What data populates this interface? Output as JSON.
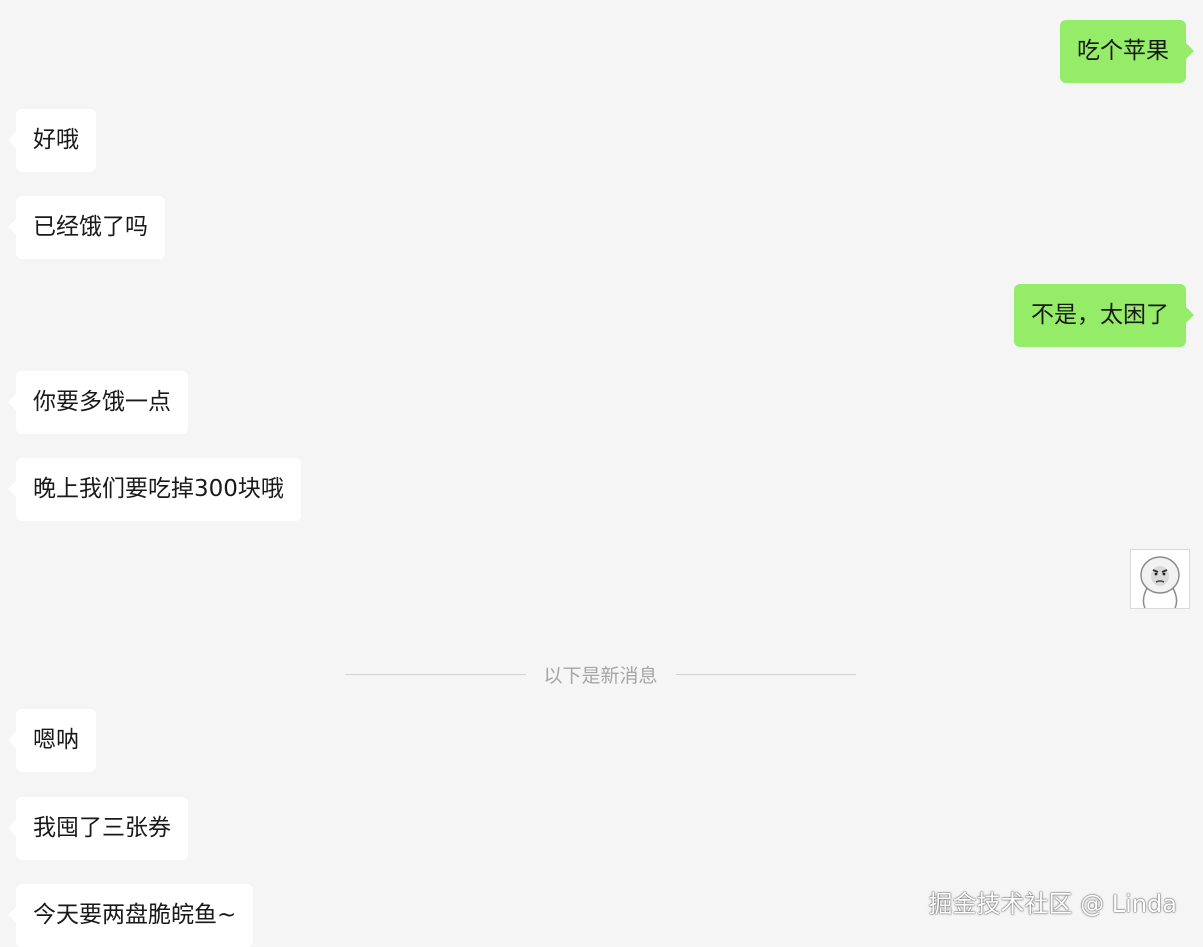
{
  "colors": {
    "background": "#f5f5f5",
    "incoming_bubble": "#ffffff",
    "outgoing_bubble": "#95ec69",
    "text": "#191919",
    "divider_text": "#a6a6a6"
  },
  "messages": [
    {
      "direction": "outgoing",
      "text": "吃个苹果"
    },
    {
      "direction": "incoming",
      "text": "好哦"
    },
    {
      "direction": "incoming",
      "text": "已经饿了吗"
    },
    {
      "direction": "outgoing",
      "text": "不是，太困了"
    },
    {
      "direction": "incoming",
      "text": "你要多饿一点"
    },
    {
      "direction": "incoming",
      "text": "晚上我们要吃掉300块哦"
    },
    {
      "direction": "outgoing",
      "type": "sticker",
      "icon": "meme-face-sticker"
    },
    {
      "direction": "incoming",
      "text": "嗯呐"
    },
    {
      "direction": "incoming",
      "text": "我囤了三张券"
    },
    {
      "direction": "incoming",
      "text": "今天要两盘脆皖鱼~"
    }
  ],
  "new_messages_divider": "以下是新消息",
  "watermark": "掘金技术社区 @ Linda"
}
